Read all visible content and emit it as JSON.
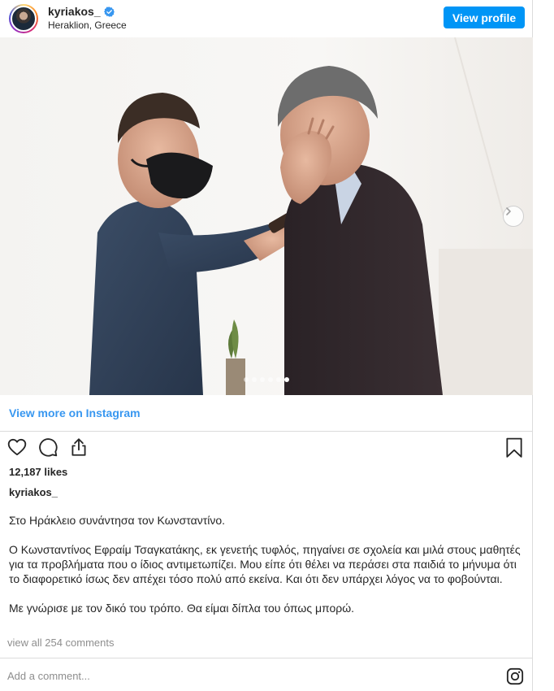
{
  "header": {
    "username": "kyriakos_",
    "location": "Heraklion, Greece",
    "view_profile_label": "View profile"
  },
  "post": {
    "carousel": {
      "slide_count": 6,
      "active_index": 5
    },
    "view_more_label": "View more on Instagram",
    "likes": "12,187 likes",
    "caption_username": "kyriakos_",
    "caption_paragraphs": [
      "Στο Ηράκλειο συνάντησα τον Κωνσταντίνο.",
      "Ο Κωνσταντίνος Εφραίμ Τσαγκατάκης, εκ γενετής τυφλός, πηγαίνει σε σχολεία και μιλά στους μαθητές για τα προβλήματα που ο ίδιος αντιμετωπίζει. Μου είπε ότι θέλει να περάσει στα παιδιά το μήνυμα ότι το διαφορετικό ίσως δεν απέχει τόσο πολύ από εκείνα. Και ότι δεν υπάρχει λόγος να το φοβούνται.",
      "Με γνώρισε με τον δικό του τρόπο. Θα είμαι δίπλα του όπως μπορώ."
    ],
    "view_comments_label": "view all 254 comments",
    "comment_placeholder": "Add a comment..."
  },
  "icons": {
    "verified": "verified-badge-icon",
    "like": "heart-icon",
    "comment": "speech-bubble-icon",
    "share": "share-icon",
    "save": "bookmark-icon",
    "next": "chevron-right-icon",
    "brand": "instagram-logo-icon"
  },
  "colors": {
    "accent": "#0095f6",
    "link": "#3897f0",
    "text": "#262626",
    "muted": "#8e8e8e",
    "border": "#dbdbdb"
  }
}
